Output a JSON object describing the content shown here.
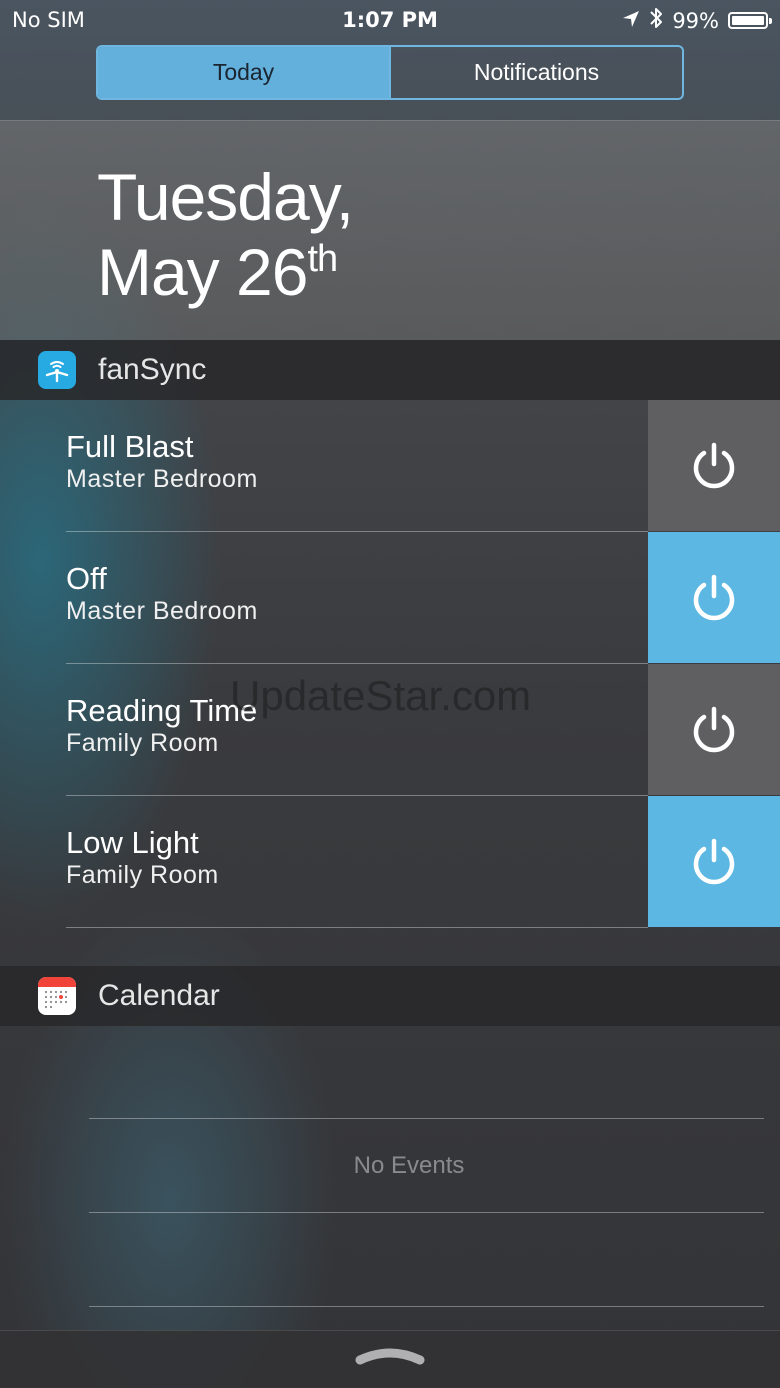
{
  "status": {
    "carrier": "No SIM",
    "time": "1:07 PM",
    "battery_percent": "99%",
    "battery_level": 0.99,
    "icons": [
      "location-arrow-icon",
      "bluetooth-icon",
      "battery-icon"
    ]
  },
  "segmented": {
    "today_label": "Today",
    "notifications_label": "Notifications",
    "selected": "Today"
  },
  "date": {
    "weekday": "Tuesday,",
    "month_day": "May 26",
    "suffix": "th"
  },
  "fansync": {
    "title": "fanSync",
    "items": [
      {
        "title": "Full Blast",
        "room": "Master Bedroom",
        "state": "off"
      },
      {
        "title": "Off",
        "room": "Master Bedroom",
        "state": "on"
      },
      {
        "title": "Reading Time",
        "room": "Family Room",
        "state": "off"
      },
      {
        "title": "Low Light",
        "room": "Family Room",
        "state": "on"
      }
    ]
  },
  "watermark": "UpdateStar.com",
  "calendar": {
    "title": "Calendar",
    "empty_text": "No Events"
  },
  "colors": {
    "accent": "#5db7e3",
    "power_off_bg": "#5f5f61",
    "segment_active": "#63b0dc"
  }
}
